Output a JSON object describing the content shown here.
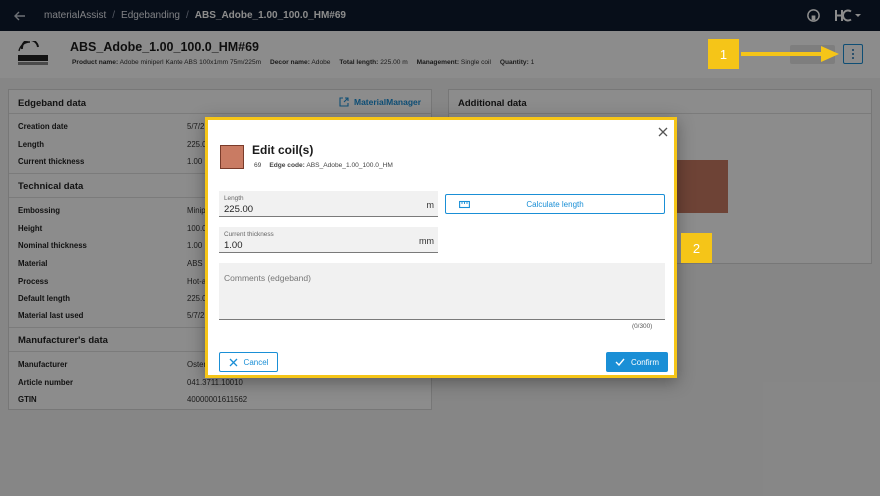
{
  "breadcrumb": {
    "items": [
      "materialAssist",
      "Edgebanding",
      "ABS_Adobe_1.00_100.0_HM#69"
    ],
    "separator": "/"
  },
  "header": {
    "title": "ABS_Adobe_1.00_100.0_HM#69",
    "meta": [
      {
        "label": "Product name:",
        "value": "Adobe miniperl Kante ABS 100x1mm 75m/225m"
      },
      {
        "label": "Decor name:",
        "value": "Adobe"
      },
      {
        "label": "Total length:",
        "value": "225.00 m"
      },
      {
        "label": "Management:",
        "value": "Single coil"
      },
      {
        "label": "Quantity:",
        "value": "1"
      }
    ]
  },
  "left_panel": {
    "title": "Edgeband data",
    "link_label": "MaterialManager",
    "edgeband_rows": [
      {
        "label": "Creation date",
        "value": "5/7/2"
      },
      {
        "label": "Length",
        "value": "225.0"
      },
      {
        "label": "Current thickness",
        "value": "1.00"
      }
    ],
    "technical_title": "Technical data",
    "technical_rows": [
      {
        "label": "Embossing",
        "value": "Minip"
      },
      {
        "label": "Height",
        "value": "100.0"
      },
      {
        "label": "Nominal thickness",
        "value": "1.00"
      },
      {
        "label": "Material",
        "value": "ABS"
      },
      {
        "label": "Process",
        "value": "Hot-a"
      },
      {
        "label": "Default length",
        "value": "225.0"
      },
      {
        "label": "Material last used",
        "value": "5/7/2"
      }
    ],
    "manufacturer_title": "Manufacturer's data",
    "manufacturer_rows": [
      {
        "label": "Manufacturer",
        "value": "Oster"
      },
      {
        "label": "Article number",
        "value": "041.3711.10010"
      },
      {
        "label": "GTIN",
        "value": "40000001611562"
      }
    ]
  },
  "right_panel": {
    "title": "Additional data",
    "swatch_color": "#c97b63"
  },
  "modal": {
    "title": "Edit coil(s)",
    "count": "69",
    "edge_code_label": "Edge code:",
    "edge_code_value": "ABS_Adobe_1.00_100.0_HM",
    "swatch_color": "#c97b63",
    "length_label": "Length",
    "length_value": "225.00",
    "length_unit": "m",
    "thickness_label": "Current thickness",
    "thickness_value": "1.00",
    "thickness_unit": "mm",
    "calculate_label": "Calculate length",
    "comments_placeholder": "Comments (edgeband)",
    "comments_counter": "(0/300)",
    "cancel_label": "Cancel",
    "confirm_label": "Confirm"
  },
  "callouts": {
    "one": "1",
    "two": "2"
  },
  "colors": {
    "accent": "#1a8fd6",
    "highlight": "#f5c518",
    "topbar": "#0d1a2e"
  }
}
